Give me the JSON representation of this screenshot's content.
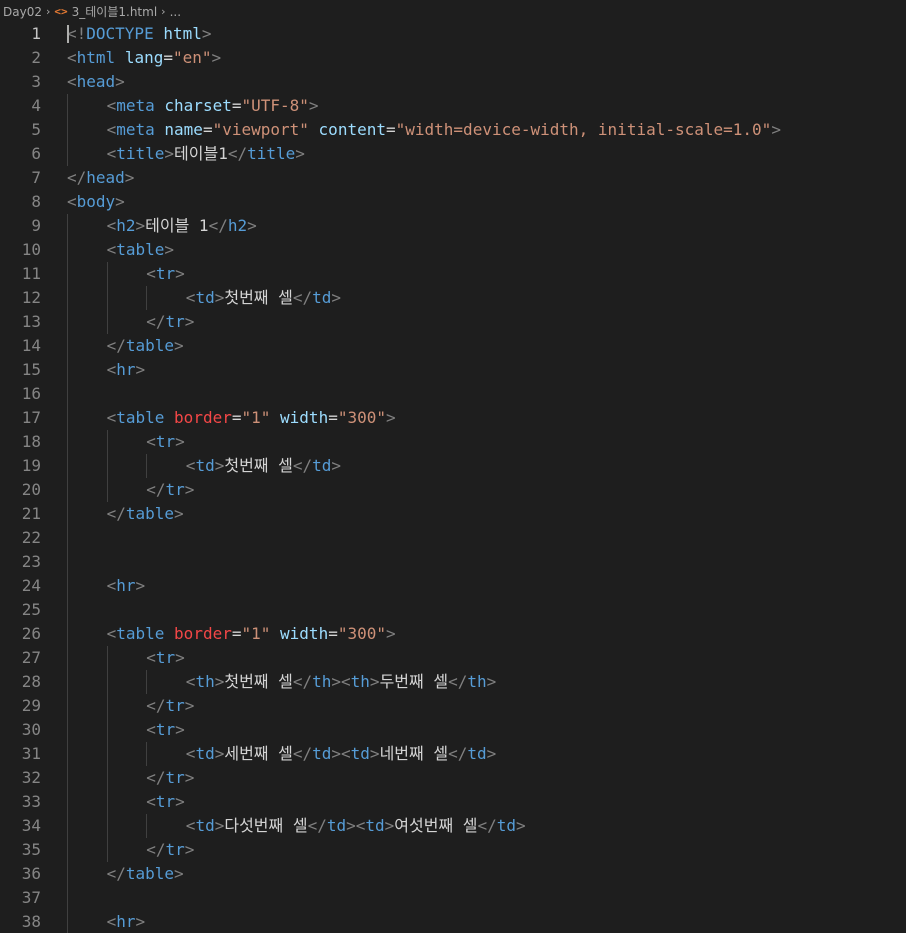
{
  "breadcrumb": {
    "folder": "Day02",
    "file_icon": "html-file-icon",
    "file_name": "3_테이블1.html",
    "more": "..."
  },
  "editor": {
    "active_line": 1,
    "lines": [
      {
        "n": "1",
        "indent": 0,
        "tokens": [
          {
            "t": "b",
            "v": "<!"
          },
          {
            "t": "t",
            "v": "DOCTYPE"
          },
          {
            "t": "x",
            "v": " "
          },
          {
            "t": "a",
            "v": "html"
          },
          {
            "t": "b",
            "v": ">"
          }
        ]
      },
      {
        "n": "2",
        "indent": 0,
        "tokens": [
          {
            "t": "b",
            "v": "<"
          },
          {
            "t": "t",
            "v": "html"
          },
          {
            "t": "x",
            "v": " "
          },
          {
            "t": "a",
            "v": "lang"
          },
          {
            "t": "x",
            "v": "="
          },
          {
            "t": "s",
            "v": "\"en\""
          },
          {
            "t": "b",
            "v": ">"
          }
        ]
      },
      {
        "n": "3",
        "indent": 0,
        "tokens": [
          {
            "t": "b",
            "v": "<"
          },
          {
            "t": "t",
            "v": "head"
          },
          {
            "t": "b",
            "v": ">"
          }
        ]
      },
      {
        "n": "4",
        "indent": 1,
        "tokens": [
          {
            "t": "b",
            "v": "<"
          },
          {
            "t": "t",
            "v": "meta"
          },
          {
            "t": "x",
            "v": " "
          },
          {
            "t": "a",
            "v": "charset"
          },
          {
            "t": "x",
            "v": "="
          },
          {
            "t": "s",
            "v": "\"UTF-8\""
          },
          {
            "t": "b",
            "v": ">"
          }
        ]
      },
      {
        "n": "5",
        "indent": 1,
        "tokens": [
          {
            "t": "b",
            "v": "<"
          },
          {
            "t": "t",
            "v": "meta"
          },
          {
            "t": "x",
            "v": " "
          },
          {
            "t": "a",
            "v": "name"
          },
          {
            "t": "x",
            "v": "="
          },
          {
            "t": "s",
            "v": "\"viewport\""
          },
          {
            "t": "x",
            "v": " "
          },
          {
            "t": "a",
            "v": "content"
          },
          {
            "t": "x",
            "v": "="
          },
          {
            "t": "s",
            "v": "\"width=device-width, initial-scale=1.0\""
          },
          {
            "t": "b",
            "v": ">"
          }
        ]
      },
      {
        "n": "6",
        "indent": 1,
        "tokens": [
          {
            "t": "b",
            "v": "<"
          },
          {
            "t": "t",
            "v": "title"
          },
          {
            "t": "b",
            "v": ">"
          },
          {
            "t": "x",
            "v": "테이블1"
          },
          {
            "t": "b",
            "v": "</"
          },
          {
            "t": "t",
            "v": "title"
          },
          {
            "t": "b",
            "v": ">"
          }
        ]
      },
      {
        "n": "7",
        "indent": 0,
        "tokens": [
          {
            "t": "b",
            "v": "</"
          },
          {
            "t": "t",
            "v": "head"
          },
          {
            "t": "b",
            "v": ">"
          }
        ]
      },
      {
        "n": "8",
        "indent": 0,
        "tokens": [
          {
            "t": "b",
            "v": "<"
          },
          {
            "t": "t",
            "v": "body"
          },
          {
            "t": "b",
            "v": ">"
          }
        ]
      },
      {
        "n": "9",
        "indent": 1,
        "tokens": [
          {
            "t": "b",
            "v": "<"
          },
          {
            "t": "t",
            "v": "h2"
          },
          {
            "t": "b",
            "v": ">"
          },
          {
            "t": "x",
            "v": "테이블 1"
          },
          {
            "t": "b",
            "v": "</"
          },
          {
            "t": "t",
            "v": "h2"
          },
          {
            "t": "b",
            "v": ">"
          }
        ]
      },
      {
        "n": "10",
        "indent": 1,
        "tokens": [
          {
            "t": "b",
            "v": "<"
          },
          {
            "t": "t",
            "v": "table"
          },
          {
            "t": "b",
            "v": ">"
          }
        ]
      },
      {
        "n": "11",
        "indent": 2,
        "tokens": [
          {
            "t": "b",
            "v": "<"
          },
          {
            "t": "t",
            "v": "tr"
          },
          {
            "t": "b",
            "v": ">"
          }
        ]
      },
      {
        "n": "12",
        "indent": 3,
        "tokens": [
          {
            "t": "b",
            "v": "<"
          },
          {
            "t": "t",
            "v": "td"
          },
          {
            "t": "b",
            "v": ">"
          },
          {
            "t": "x",
            "v": "첫번째 셀"
          },
          {
            "t": "b",
            "v": "</"
          },
          {
            "t": "t",
            "v": "td"
          },
          {
            "t": "b",
            "v": ">"
          }
        ]
      },
      {
        "n": "13",
        "indent": 2,
        "tokens": [
          {
            "t": "b",
            "v": "</"
          },
          {
            "t": "t",
            "v": "tr"
          },
          {
            "t": "b",
            "v": ">"
          }
        ]
      },
      {
        "n": "14",
        "indent": 1,
        "tokens": [
          {
            "t": "b",
            "v": "</"
          },
          {
            "t": "t",
            "v": "table"
          },
          {
            "t": "b",
            "v": ">"
          }
        ]
      },
      {
        "n": "15",
        "indent": 1,
        "tokens": [
          {
            "t": "b",
            "v": "<"
          },
          {
            "t": "t",
            "v": "hr"
          },
          {
            "t": "b",
            "v": ">"
          }
        ]
      },
      {
        "n": "16",
        "indent": 1,
        "tokens": []
      },
      {
        "n": "17",
        "indent": 1,
        "tokens": [
          {
            "t": "b",
            "v": "<"
          },
          {
            "t": "t",
            "v": "table"
          },
          {
            "t": "x",
            "v": " "
          },
          {
            "t": "ar",
            "v": "border"
          },
          {
            "t": "x",
            "v": "="
          },
          {
            "t": "s",
            "v": "\"1\""
          },
          {
            "t": "x",
            "v": " "
          },
          {
            "t": "a",
            "v": "width"
          },
          {
            "t": "x",
            "v": "="
          },
          {
            "t": "s",
            "v": "\"300\""
          },
          {
            "t": "b",
            "v": ">"
          }
        ]
      },
      {
        "n": "18",
        "indent": 2,
        "tokens": [
          {
            "t": "b",
            "v": "<"
          },
          {
            "t": "t",
            "v": "tr"
          },
          {
            "t": "b",
            "v": ">"
          }
        ]
      },
      {
        "n": "19",
        "indent": 3,
        "tokens": [
          {
            "t": "b",
            "v": "<"
          },
          {
            "t": "t",
            "v": "td"
          },
          {
            "t": "b",
            "v": ">"
          },
          {
            "t": "x",
            "v": "첫번째 셀"
          },
          {
            "t": "b",
            "v": "</"
          },
          {
            "t": "t",
            "v": "td"
          },
          {
            "t": "b",
            "v": ">"
          }
        ]
      },
      {
        "n": "20",
        "indent": 2,
        "tokens": [
          {
            "t": "b",
            "v": "</"
          },
          {
            "t": "t",
            "v": "tr"
          },
          {
            "t": "b",
            "v": ">"
          }
        ]
      },
      {
        "n": "21",
        "indent": 1,
        "tokens": [
          {
            "t": "b",
            "v": "</"
          },
          {
            "t": "t",
            "v": "table"
          },
          {
            "t": "b",
            "v": ">"
          }
        ]
      },
      {
        "n": "22",
        "indent": 1,
        "tokens": []
      },
      {
        "n": "23",
        "indent": 1,
        "tokens": []
      },
      {
        "n": "24",
        "indent": 1,
        "tokens": [
          {
            "t": "b",
            "v": "<"
          },
          {
            "t": "t",
            "v": "hr"
          },
          {
            "t": "b",
            "v": ">"
          }
        ]
      },
      {
        "n": "25",
        "indent": 1,
        "tokens": []
      },
      {
        "n": "26",
        "indent": 1,
        "tokens": [
          {
            "t": "b",
            "v": "<"
          },
          {
            "t": "t",
            "v": "table"
          },
          {
            "t": "x",
            "v": " "
          },
          {
            "t": "ar",
            "v": "border"
          },
          {
            "t": "x",
            "v": "="
          },
          {
            "t": "s",
            "v": "\"1\""
          },
          {
            "t": "x",
            "v": " "
          },
          {
            "t": "a",
            "v": "width"
          },
          {
            "t": "x",
            "v": "="
          },
          {
            "t": "s",
            "v": "\"300\""
          },
          {
            "t": "b",
            "v": ">"
          }
        ]
      },
      {
        "n": "27",
        "indent": 2,
        "tokens": [
          {
            "t": "b",
            "v": "<"
          },
          {
            "t": "t",
            "v": "tr"
          },
          {
            "t": "b",
            "v": ">"
          }
        ]
      },
      {
        "n": "28",
        "indent": 3,
        "tokens": [
          {
            "t": "b",
            "v": "<"
          },
          {
            "t": "t",
            "v": "th"
          },
          {
            "t": "b",
            "v": ">"
          },
          {
            "t": "x",
            "v": "첫번째 셀"
          },
          {
            "t": "b",
            "v": "</"
          },
          {
            "t": "t",
            "v": "th"
          },
          {
            "t": "b",
            "v": "><"
          },
          {
            "t": "t",
            "v": "th"
          },
          {
            "t": "b",
            "v": ">"
          },
          {
            "t": "x",
            "v": "두번째 셀"
          },
          {
            "t": "b",
            "v": "</"
          },
          {
            "t": "t",
            "v": "th"
          },
          {
            "t": "b",
            "v": ">"
          }
        ]
      },
      {
        "n": "29",
        "indent": 2,
        "tokens": [
          {
            "t": "b",
            "v": "</"
          },
          {
            "t": "t",
            "v": "tr"
          },
          {
            "t": "b",
            "v": ">"
          }
        ]
      },
      {
        "n": "30",
        "indent": 2,
        "tokens": [
          {
            "t": "b",
            "v": "<"
          },
          {
            "t": "t",
            "v": "tr"
          },
          {
            "t": "b",
            "v": ">"
          }
        ]
      },
      {
        "n": "31",
        "indent": 3,
        "tokens": [
          {
            "t": "b",
            "v": "<"
          },
          {
            "t": "t",
            "v": "td"
          },
          {
            "t": "b",
            "v": ">"
          },
          {
            "t": "x",
            "v": "세번째 셀"
          },
          {
            "t": "b",
            "v": "</"
          },
          {
            "t": "t",
            "v": "td"
          },
          {
            "t": "b",
            "v": "><"
          },
          {
            "t": "t",
            "v": "td"
          },
          {
            "t": "b",
            "v": ">"
          },
          {
            "t": "x",
            "v": "네번째 셀"
          },
          {
            "t": "b",
            "v": "</"
          },
          {
            "t": "t",
            "v": "td"
          },
          {
            "t": "b",
            "v": ">"
          }
        ]
      },
      {
        "n": "32",
        "indent": 2,
        "tokens": [
          {
            "t": "b",
            "v": "</"
          },
          {
            "t": "t",
            "v": "tr"
          },
          {
            "t": "b",
            "v": ">"
          }
        ]
      },
      {
        "n": "33",
        "indent": 2,
        "tokens": [
          {
            "t": "b",
            "v": "<"
          },
          {
            "t": "t",
            "v": "tr"
          },
          {
            "t": "b",
            "v": ">"
          }
        ]
      },
      {
        "n": "34",
        "indent": 3,
        "tokens": [
          {
            "t": "b",
            "v": "<"
          },
          {
            "t": "t",
            "v": "td"
          },
          {
            "t": "b",
            "v": ">"
          },
          {
            "t": "x",
            "v": "다섯번째 셀"
          },
          {
            "t": "b",
            "v": "</"
          },
          {
            "t": "t",
            "v": "td"
          },
          {
            "t": "b",
            "v": "><"
          },
          {
            "t": "t",
            "v": "td"
          },
          {
            "t": "b",
            "v": ">"
          },
          {
            "t": "x",
            "v": "여섯번째 셀"
          },
          {
            "t": "b",
            "v": "</"
          },
          {
            "t": "t",
            "v": "td"
          },
          {
            "t": "b",
            "v": ">"
          }
        ]
      },
      {
        "n": "35",
        "indent": 2,
        "tokens": [
          {
            "t": "b",
            "v": "</"
          },
          {
            "t": "t",
            "v": "tr"
          },
          {
            "t": "b",
            "v": ">"
          }
        ]
      },
      {
        "n": "36",
        "indent": 1,
        "tokens": [
          {
            "t": "b",
            "v": "</"
          },
          {
            "t": "t",
            "v": "table"
          },
          {
            "t": "b",
            "v": ">"
          }
        ]
      },
      {
        "n": "37",
        "indent": 1,
        "tokens": []
      },
      {
        "n": "38",
        "indent": 1,
        "tokens": [
          {
            "t": "b",
            "v": "<"
          },
          {
            "t": "t",
            "v": "hr"
          },
          {
            "t": "b",
            "v": ">"
          }
        ]
      }
    ]
  },
  "colors": {
    "background": "#1e1e1e",
    "tag_bracket": "#808080",
    "tag_name": "#569cd6",
    "attribute": "#9cdcfe",
    "deprecated_attribute": "#f44747",
    "string": "#ce9178",
    "text": "#d4d4d4",
    "line_number": "#858585",
    "active_line_number": "#c6c6c6"
  }
}
